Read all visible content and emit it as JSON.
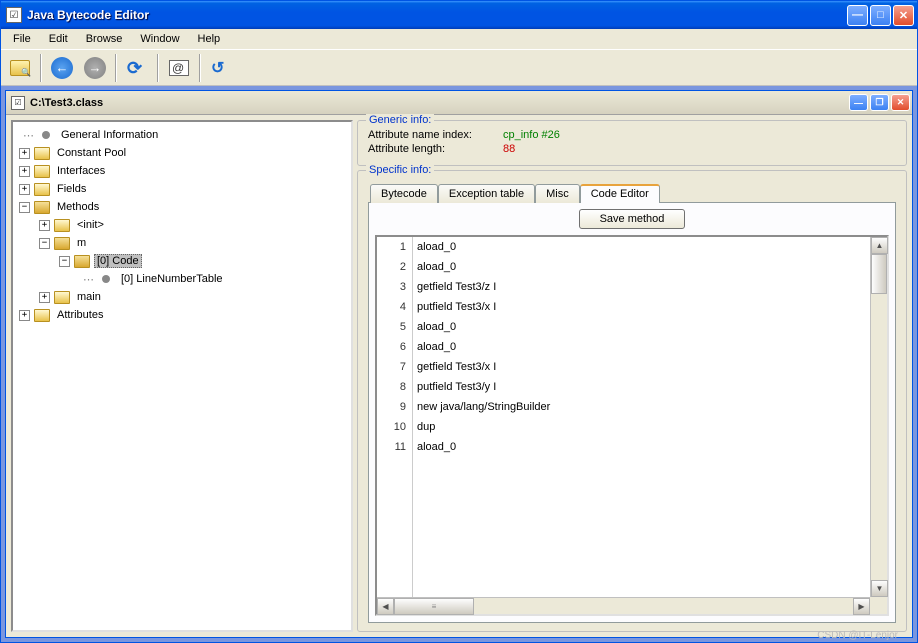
{
  "window": {
    "title": "Java Bytecode Editor"
  },
  "menu": {
    "file": "File",
    "edit": "Edit",
    "browse": "Browse",
    "window": "Window",
    "help": "Help"
  },
  "document": {
    "title": "C:\\Test3.class"
  },
  "tree": {
    "general_info": "General Information",
    "constant_pool": "Constant Pool",
    "interfaces": "Interfaces",
    "fields": "Fields",
    "methods": "Methods",
    "init": "<init>",
    "m": "m",
    "code0": "[0] Code",
    "line_number_table": "[0] LineNumberTable",
    "main": "main",
    "attributes": "Attributes"
  },
  "generic_info": {
    "legend": "Generic info:",
    "attr_name_label": "Attribute name index:",
    "attr_name_value": "cp_info #26",
    "attr_len_label": "Attribute length:",
    "attr_len_value": "88"
  },
  "specific_info": {
    "legend": "Specific info:"
  },
  "tabs": {
    "bytecode": "Bytecode",
    "exception": "Exception table",
    "misc": "Misc",
    "code_editor": "Code Editor"
  },
  "buttons": {
    "save_method": "Save method"
  },
  "code_lines": [
    "aload_0",
    "aload_0",
    "getfield Test3/z I",
    "putfield Test3/x I",
    "aload_0",
    "aload_0",
    "getfield Test3/x I",
    "putfield Test3/y I",
    "new java/lang/StringBuilder",
    "dup",
    "aload_0"
  ],
  "watermark": "CSDN @IT-Lenjor"
}
